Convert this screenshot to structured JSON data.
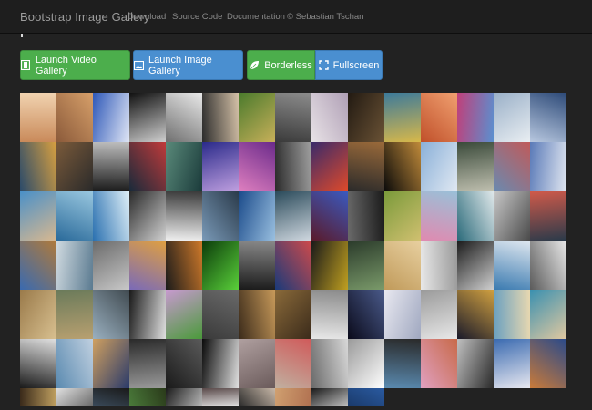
{
  "navbar": {
    "brand": "Bootstrap Image Gallery",
    "links": [
      "Download",
      "Source Code",
      "Documentation",
      "© Sebastian Tschan"
    ]
  },
  "buttons": {
    "video": "Launch Video Gallery",
    "image": "Launch Image Gallery",
    "borderless": "Borderless",
    "fullscreen": "Fullscreen"
  },
  "colors": {
    "page_background": "#222222",
    "navbar_background": "#1e1e1e",
    "button_green": "#4cae4c",
    "button_blue": "#4a8fd0"
  },
  "icons": [
    "film-icon",
    "picture-icon",
    "leaf-icon",
    "fullscreen-icon"
  ]
}
